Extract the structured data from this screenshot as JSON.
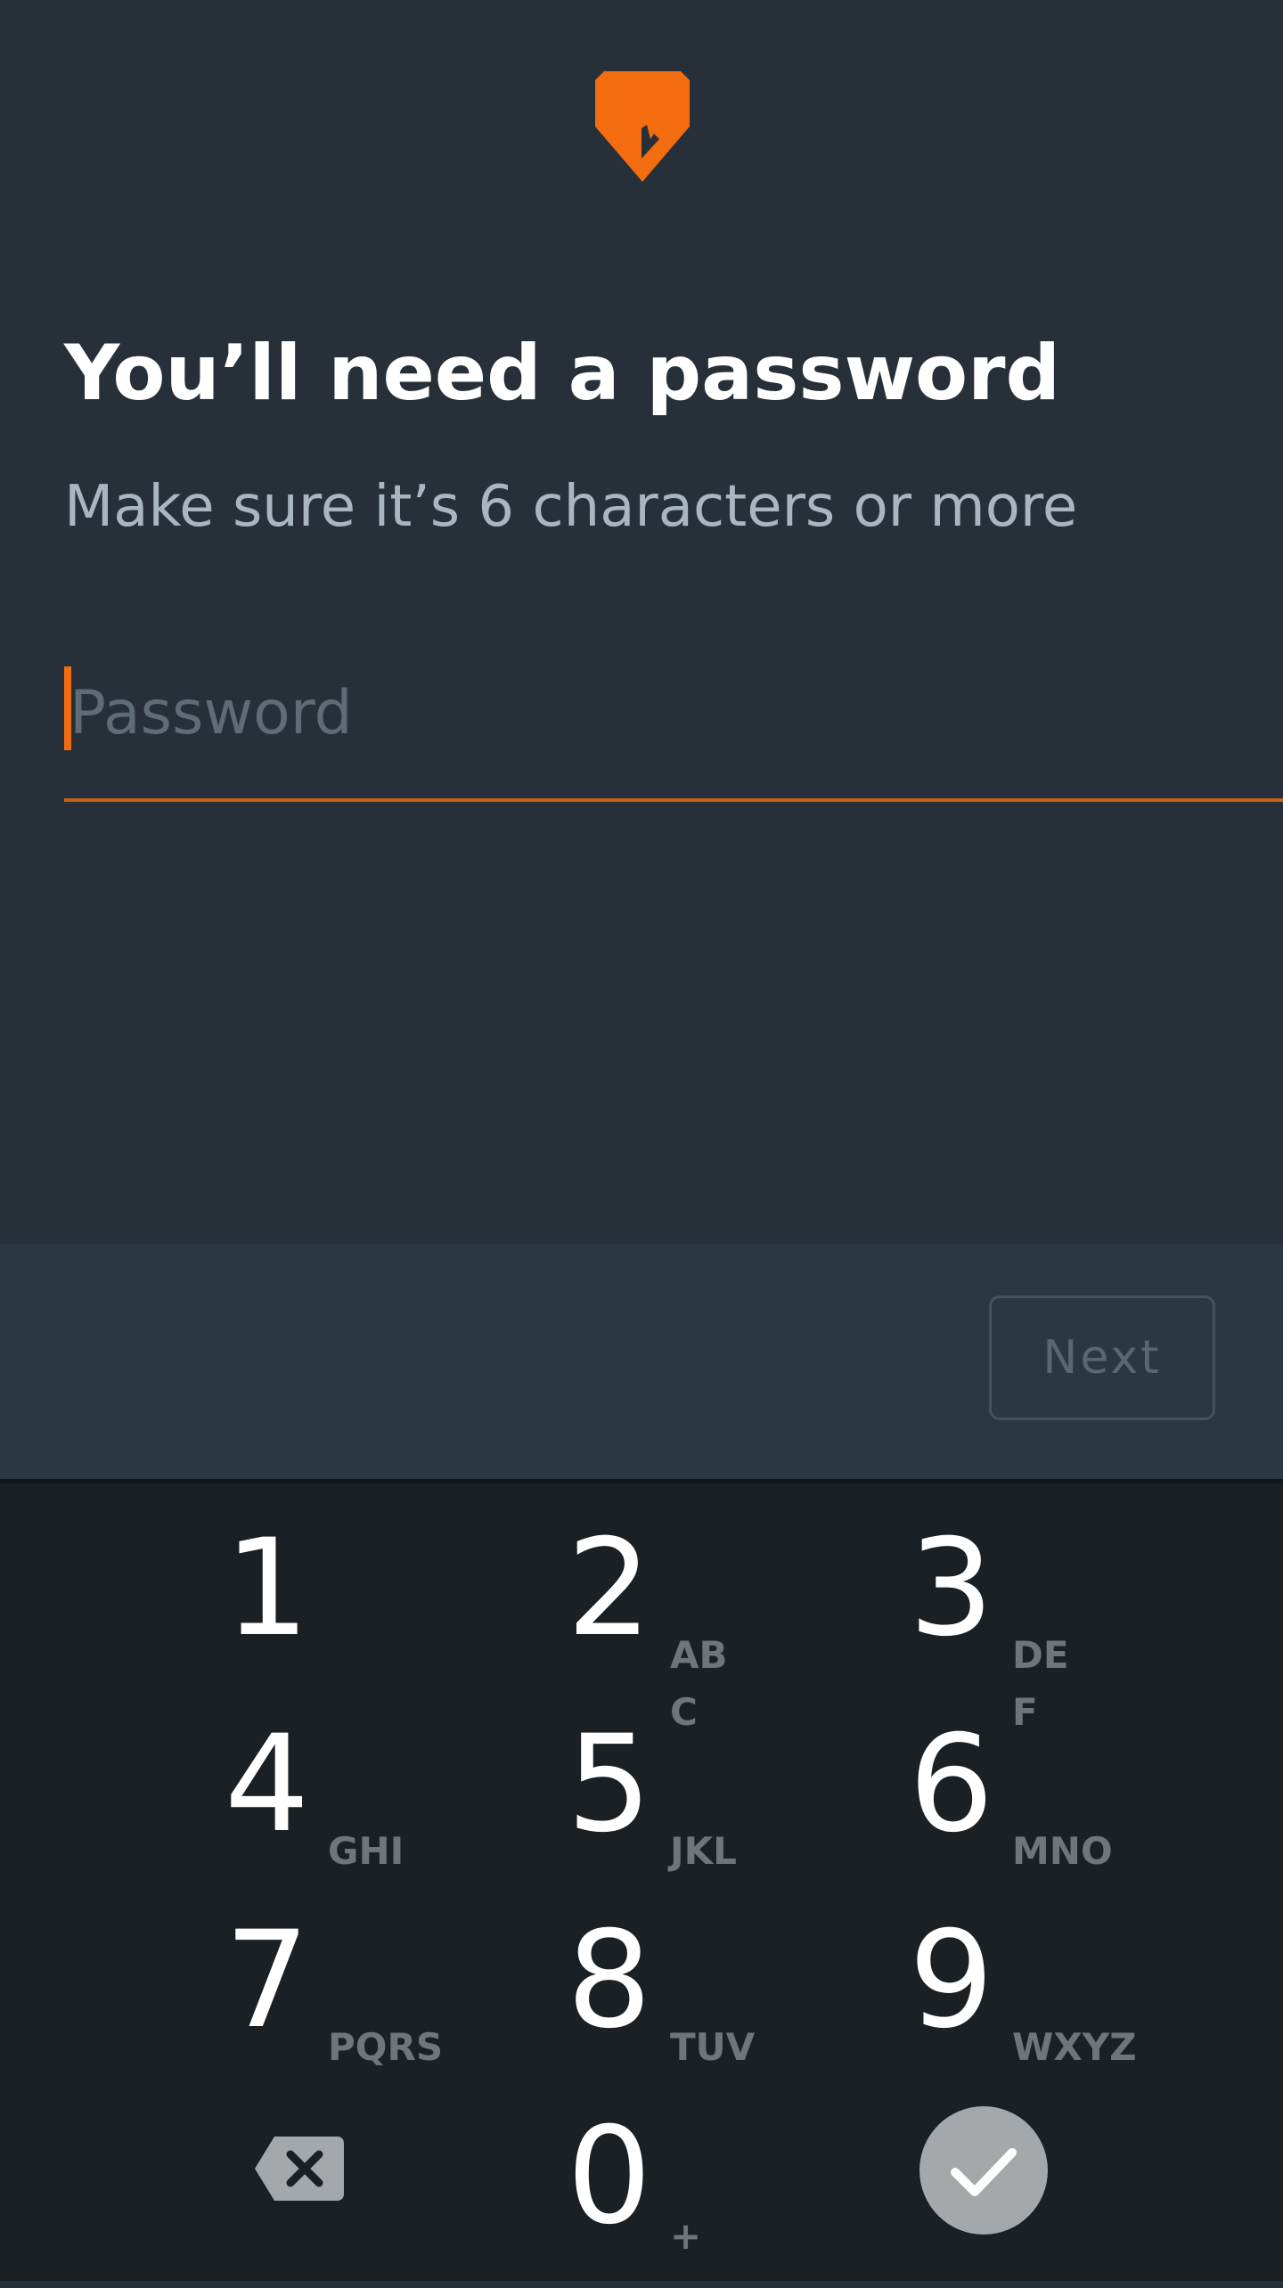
{
  "header": {
    "logo_icon": "orange-tag-logo",
    "title": "You’ll need a password",
    "subtitle": "Make sure it’s 6 characters or more"
  },
  "password_field": {
    "value": "",
    "placeholder": "Password"
  },
  "actions": {
    "next_label": "Next"
  },
  "keypad": {
    "keys": [
      {
        "digit": "1",
        "letters": ""
      },
      {
        "digit": "2",
        "letters": "ABC"
      },
      {
        "digit": "3",
        "letters": "DEF"
      },
      {
        "digit": "4",
        "letters": "GHI"
      },
      {
        "digit": "5",
        "letters": "JKL"
      },
      {
        "digit": "6",
        "letters": "MNO"
      },
      {
        "digit": "7",
        "letters": "PQRS"
      },
      {
        "digit": "8",
        "letters": "TUV"
      },
      {
        "digit": "9",
        "letters": "WXYZ"
      },
      {
        "digit": "0",
        "letters": "+"
      }
    ],
    "backspace_icon": "backspace-icon",
    "done_icon": "checkmark-icon"
  },
  "colors": {
    "background": "#273038",
    "accent": "#f36c10",
    "keypad_background": "#1b2025"
  }
}
